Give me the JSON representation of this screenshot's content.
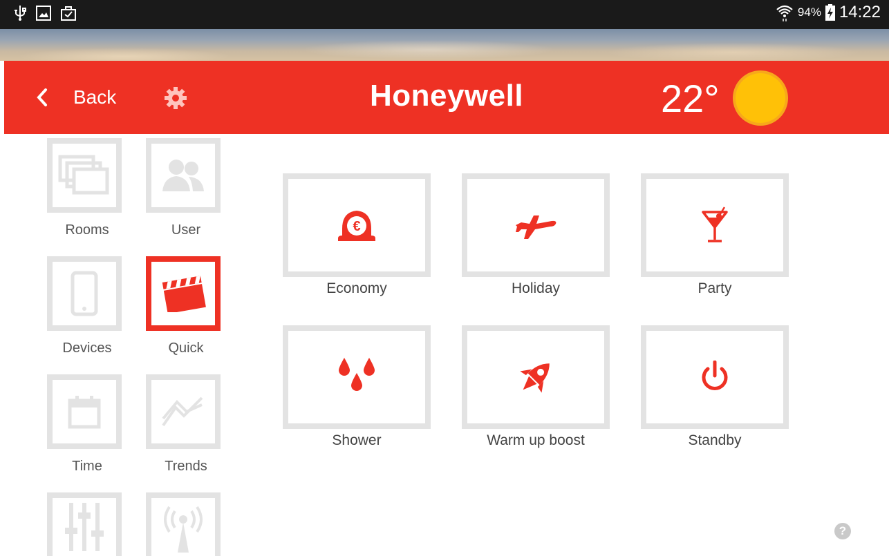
{
  "status_bar": {
    "battery_percent": "94%",
    "time": "14:22",
    "icons_left": [
      "usb-icon",
      "image-icon",
      "briefcase-icon"
    ],
    "icons_right": [
      "wifi-icon",
      "battery-charging-icon"
    ]
  },
  "header": {
    "back_label": "Back",
    "brand": "Honeywell",
    "temperature": "22°",
    "weather_icon": "sun-icon",
    "accent_color": "#ee3124",
    "sun_color": "#ffc107"
  },
  "nav": {
    "items": [
      {
        "label": "Rooms",
        "icon": "rooms-icon"
      },
      {
        "label": "User",
        "icon": "users-icon"
      },
      {
        "label": "Devices",
        "icon": "phone-icon"
      },
      {
        "label": "Quick",
        "icon": "clapperboard-icon",
        "active": true
      },
      {
        "label": "Time",
        "icon": "calendar-icon"
      },
      {
        "label": "Trends",
        "icon": "trend-icon"
      },
      {
        "label": "",
        "icon": "sliders-icon"
      },
      {
        "label": "",
        "icon": "antenna-icon"
      }
    ]
  },
  "quick": {
    "tiles": [
      {
        "label": "Economy",
        "icon": "euro-icon"
      },
      {
        "label": "Holiday",
        "icon": "airplane-icon"
      },
      {
        "label": "Party",
        "icon": "cocktail-icon"
      },
      {
        "label": "Shower",
        "icon": "drops-icon"
      },
      {
        "label": "Warm up boost",
        "icon": "rocket-icon"
      },
      {
        "label": "Standby",
        "icon": "power-icon"
      }
    ]
  },
  "help": {
    "label": "?"
  }
}
